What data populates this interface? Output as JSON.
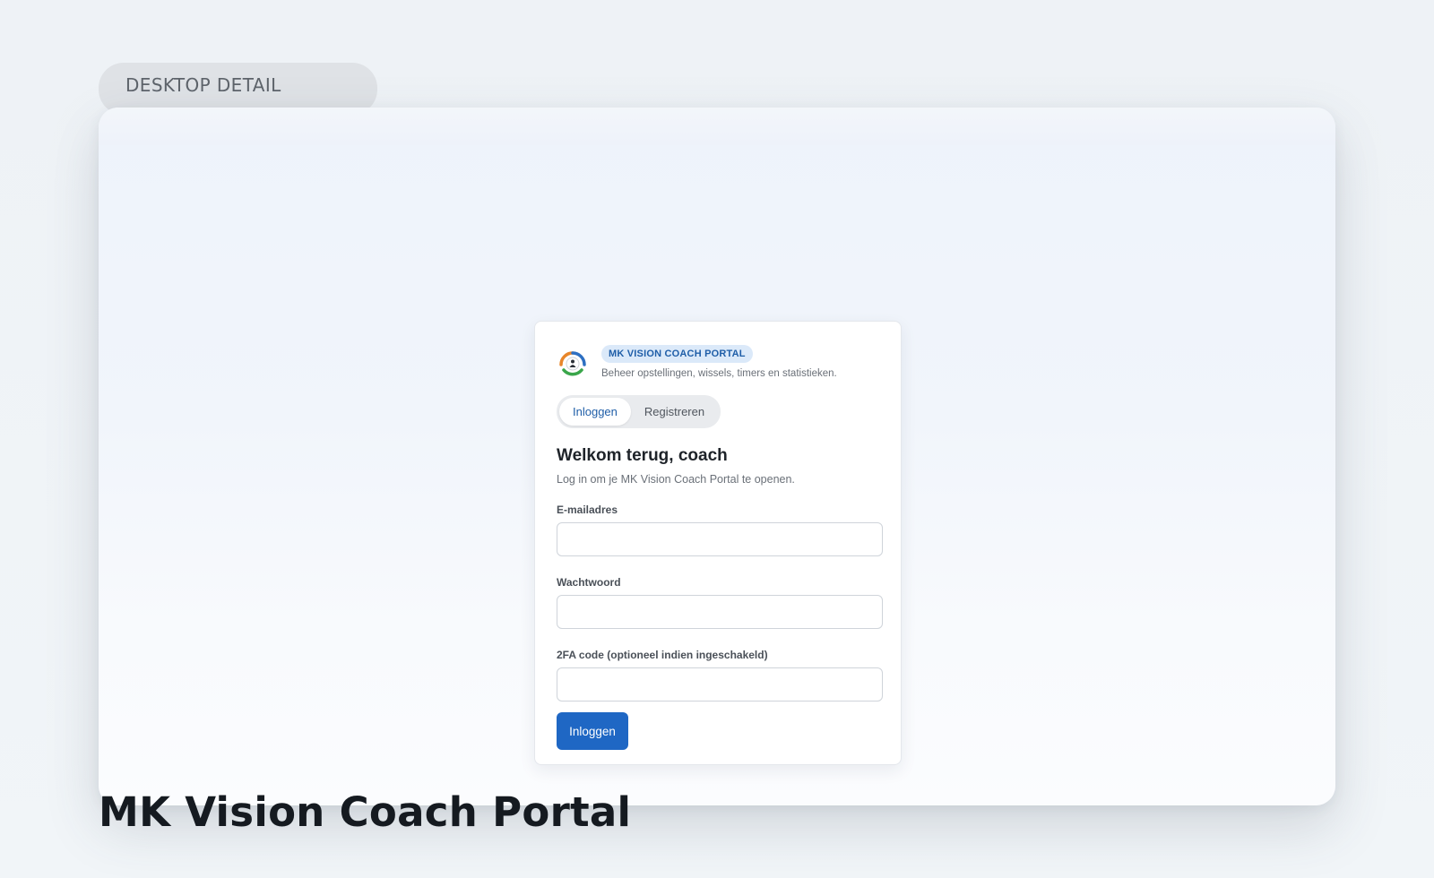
{
  "section_label": "DESKTOP DETAIL",
  "page_heading": "MK Vision Coach Portal",
  "login_card": {
    "brand_badge": "MK VISION COACH PORTAL",
    "brand_subtitle": "Beheer opstellingen, wissels, timers en statistieken.",
    "logo_icon": "team-coach-logo-icon",
    "tabs": [
      {
        "label": "Inloggen",
        "active": true
      },
      {
        "label": "Registreren",
        "active": false
      }
    ],
    "welcome_title": "Welkom terug, coach",
    "welcome_subtitle": "Log in om je MK Vision Coach Portal te openen.",
    "fields": {
      "email_label": "E-mailadres",
      "email_value": "",
      "password_label": "Wachtwoord",
      "password_value": "",
      "twofa_label": "2FA code (optioneel indien ingeschakeld)",
      "twofa_value": ""
    },
    "submit_label": "Inloggen"
  },
  "colors": {
    "accent": "#1f67c4",
    "badge_bg": "#dbe9f9",
    "badge_text": "#1f5ea8"
  }
}
